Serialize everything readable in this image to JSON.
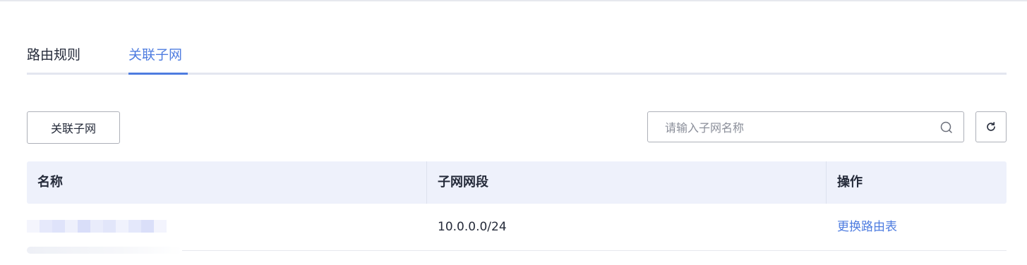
{
  "tabs": [
    {
      "label": "路由规则",
      "active": false
    },
    {
      "label": "关联子网",
      "active": true
    }
  ],
  "toolbar": {
    "associate_label": "关联子网",
    "search_placeholder": "请输入子网名称",
    "search_value": ""
  },
  "table": {
    "columns": [
      "名称",
      "子网网段",
      "操作"
    ],
    "rows": [
      {
        "name": "",
        "cidr": "10.0.0.0/24",
        "action": "更换路由表"
      }
    ]
  },
  "colors": {
    "accent": "#4e7ce0",
    "header_bg": "#eef1fb",
    "border": "#adb0b8"
  },
  "icons": [
    "search-icon",
    "refresh-icon"
  ]
}
